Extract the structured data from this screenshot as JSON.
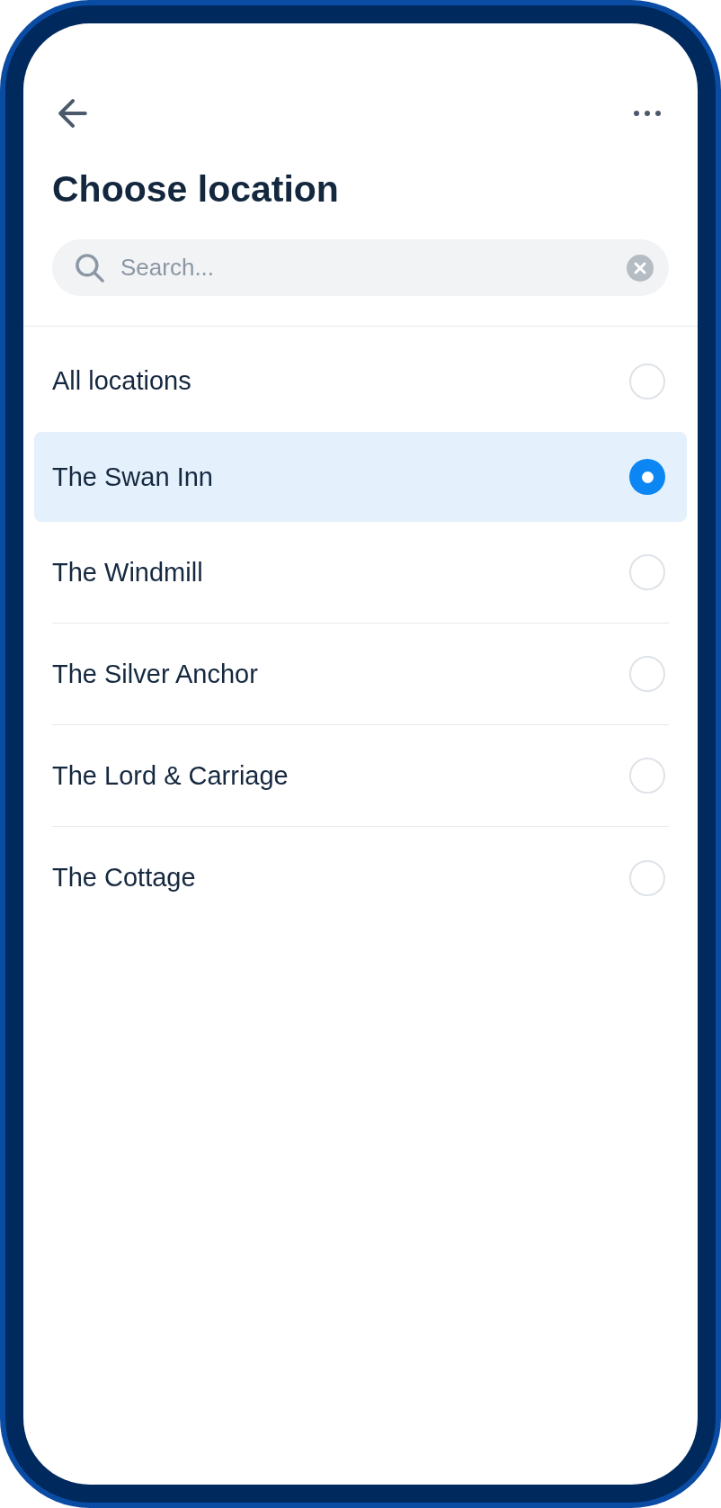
{
  "title": "Choose location",
  "search": {
    "placeholder": "Search..."
  },
  "locations": [
    {
      "name": "All locations",
      "selected": false
    },
    {
      "name": "The Swan Inn",
      "selected": true
    },
    {
      "name": "The Windmill",
      "selected": false
    },
    {
      "name": "The Silver Anchor",
      "selected": false
    },
    {
      "name": "The Lord & Carriage",
      "selected": false
    },
    {
      "name": "The Cottage",
      "selected": false
    }
  ]
}
